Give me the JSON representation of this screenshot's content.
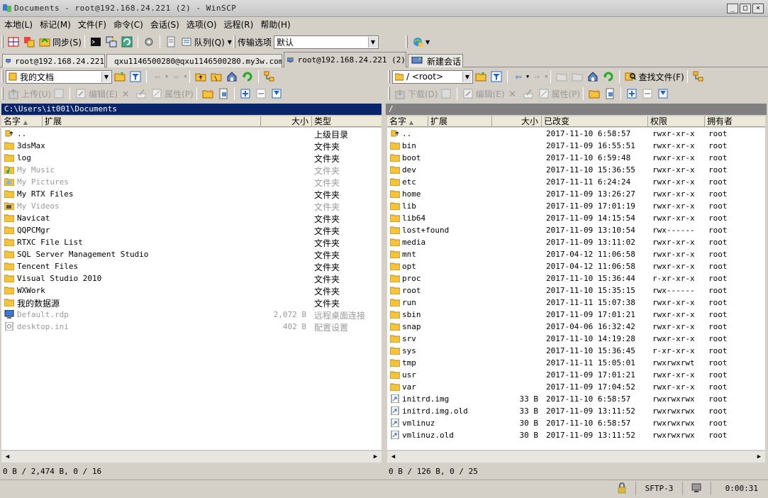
{
  "window": {
    "title": "Documents - root@192.168.24.221 (2) - WinSCP",
    "min": "_",
    "max": "□",
    "close": "×"
  },
  "menu": [
    "本地(L)",
    "标记(M)",
    "文件(F)",
    "命令(C)",
    "会话(S)",
    "选项(O)",
    "远程(R)",
    "帮助(H)"
  ],
  "toolbar1": {
    "sync": "同步(S)",
    "queue": "队列(Q)",
    "transfer_label": "传输选项",
    "transfer_value": "默认"
  },
  "tabs": [
    {
      "label": "root@192.168.24.221"
    },
    {
      "label": "qxu1146500280@qxu1146500280.my3w.com"
    },
    {
      "label": "root@192.168.24.221 (2)"
    },
    {
      "label": "新建会话"
    }
  ],
  "local": {
    "location": "我的文档",
    "upload": "上传(U)",
    "edit": "编辑(E)",
    "props": "属性(P)",
    "path": "C:\\Users\\it001\\Documents",
    "cols": {
      "name": "名字",
      "ext": "扩展",
      "size": "大小",
      "type": "类型"
    },
    "files": [
      {
        "name": "..",
        "size": "",
        "type": "上级目录",
        "icon": "parent-dir-icon",
        "dim": false
      },
      {
        "name": "3dsMax",
        "size": "",
        "type": "文件夹",
        "icon": "folder-icon",
        "dim": false
      },
      {
        "name": "log",
        "size": "",
        "type": "文件夹",
        "icon": "folder-icon",
        "dim": false
      },
      {
        "name": "My Music",
        "size": "",
        "type": "文件夹",
        "icon": "music-folder-icon",
        "dim": true
      },
      {
        "name": "My Pictures",
        "size": "",
        "type": "文件夹",
        "icon": "pictures-folder-icon",
        "dim": true
      },
      {
        "name": "My RTX Files",
        "size": "",
        "type": "文件夹",
        "icon": "folder-icon",
        "dim": false
      },
      {
        "name": "My Videos",
        "size": "",
        "type": "文件夹",
        "icon": "videos-folder-icon",
        "dim": true
      },
      {
        "name": "Navicat",
        "size": "",
        "type": "文件夹",
        "icon": "folder-icon",
        "dim": false
      },
      {
        "name": "QQPCMgr",
        "size": "",
        "type": "文件夹",
        "icon": "folder-icon",
        "dim": false
      },
      {
        "name": "RTXC File List",
        "size": "",
        "type": "文件夹",
        "icon": "folder-icon",
        "dim": false
      },
      {
        "name": "SQL Server Management Studio",
        "size": "",
        "type": "文件夹",
        "icon": "folder-icon",
        "dim": false
      },
      {
        "name": "Tencent Files",
        "size": "",
        "type": "文件夹",
        "icon": "folder-icon",
        "dim": false
      },
      {
        "name": "Visual Studio 2010",
        "size": "",
        "type": "文件夹",
        "icon": "folder-icon",
        "dim": false
      },
      {
        "name": "WXWork",
        "size": "",
        "type": "文件夹",
        "icon": "folder-icon",
        "dim": false
      },
      {
        "name": "我的数据源",
        "size": "",
        "type": "文件夹",
        "icon": "folder-icon",
        "dim": false
      },
      {
        "name": "Default.rdp",
        "size": "2,072 B",
        "type": "远程桌面连接",
        "icon": "rdp-file-icon",
        "dim": true
      },
      {
        "name": "desktop.ini",
        "size": "402 B",
        "type": "配置设置",
        "icon": "ini-file-icon",
        "dim": true
      }
    ],
    "status": "0 B / 2,474 B,  0 / 16"
  },
  "remote": {
    "location": "/ <root>",
    "download": "下载(D)",
    "edit": "编辑(E)",
    "props": "属性(P)",
    "find": "查找文件(F)",
    "path": "/",
    "cols": {
      "name": "名字",
      "ext": "扩展",
      "size": "大小",
      "changed": "已改变",
      "rights": "权限",
      "owner": "拥有者"
    },
    "files": [
      {
        "name": "..",
        "size": "",
        "changed": "2017-11-10 6:58:57",
        "rights": "rwxr-xr-x",
        "owner": "root",
        "icon": "parent-dir-icon"
      },
      {
        "name": "bin",
        "size": "",
        "changed": "2017-11-09 16:55:51",
        "rights": "rwxr-xr-x",
        "owner": "root",
        "icon": "folder-icon"
      },
      {
        "name": "boot",
        "size": "",
        "changed": "2017-11-10 6:59:48",
        "rights": "rwxr-xr-x",
        "owner": "root",
        "icon": "folder-icon"
      },
      {
        "name": "dev",
        "size": "",
        "changed": "2017-11-10 15:36:55",
        "rights": "rwxr-xr-x",
        "owner": "root",
        "icon": "folder-icon"
      },
      {
        "name": "etc",
        "size": "",
        "changed": "2017-11-11 6:24:24",
        "rights": "rwxr-xr-x",
        "owner": "root",
        "icon": "folder-icon"
      },
      {
        "name": "home",
        "size": "",
        "changed": "2017-11-09 13:26:27",
        "rights": "rwxr-xr-x",
        "owner": "root",
        "icon": "folder-icon"
      },
      {
        "name": "lib",
        "size": "",
        "changed": "2017-11-09 17:01:19",
        "rights": "rwxr-xr-x",
        "owner": "root",
        "icon": "folder-icon"
      },
      {
        "name": "lib64",
        "size": "",
        "changed": "2017-11-09 14:15:54",
        "rights": "rwxr-xr-x",
        "owner": "root",
        "icon": "folder-icon"
      },
      {
        "name": "lost+found",
        "size": "",
        "changed": "2017-11-09 13:10:54",
        "rights": "rwx------",
        "owner": "root",
        "icon": "folder-icon"
      },
      {
        "name": "media",
        "size": "",
        "changed": "2017-11-09 13:11:02",
        "rights": "rwxr-xr-x",
        "owner": "root",
        "icon": "folder-icon"
      },
      {
        "name": "mnt",
        "size": "",
        "changed": "2017-04-12 11:06:58",
        "rights": "rwxr-xr-x",
        "owner": "root",
        "icon": "folder-icon"
      },
      {
        "name": "opt",
        "size": "",
        "changed": "2017-04-12 11:06:58",
        "rights": "rwxr-xr-x",
        "owner": "root",
        "icon": "folder-icon"
      },
      {
        "name": "proc",
        "size": "",
        "changed": "2017-11-10 15:36:44",
        "rights": "r-xr-xr-x",
        "owner": "root",
        "icon": "folder-icon"
      },
      {
        "name": "root",
        "size": "",
        "changed": "2017-11-10 15:35:15",
        "rights": "rwx------",
        "owner": "root",
        "icon": "folder-icon"
      },
      {
        "name": "run",
        "size": "",
        "changed": "2017-11-11 15:07:38",
        "rights": "rwxr-xr-x",
        "owner": "root",
        "icon": "folder-icon"
      },
      {
        "name": "sbin",
        "size": "",
        "changed": "2017-11-09 17:01:21",
        "rights": "rwxr-xr-x",
        "owner": "root",
        "icon": "folder-icon"
      },
      {
        "name": "snap",
        "size": "",
        "changed": "2017-04-06 16:32:42",
        "rights": "rwxr-xr-x",
        "owner": "root",
        "icon": "folder-icon"
      },
      {
        "name": "srv",
        "size": "",
        "changed": "2017-11-10 14:19:28",
        "rights": "rwxr-xr-x",
        "owner": "root",
        "icon": "folder-icon"
      },
      {
        "name": "sys",
        "size": "",
        "changed": "2017-11-10 15:36:45",
        "rights": "r-xr-xr-x",
        "owner": "root",
        "icon": "folder-icon"
      },
      {
        "name": "tmp",
        "size": "",
        "changed": "2017-11-11 15:05:01",
        "rights": "rwxrwxrwt",
        "owner": "root",
        "icon": "folder-icon"
      },
      {
        "name": "usr",
        "size": "",
        "changed": "2017-11-09 17:01:21",
        "rights": "rwxr-xr-x",
        "owner": "root",
        "icon": "folder-icon"
      },
      {
        "name": "var",
        "size": "",
        "changed": "2017-11-09 17:04:52",
        "rights": "rwxr-xr-x",
        "owner": "root",
        "icon": "folder-icon"
      },
      {
        "name": "initrd.img",
        "size": "33 B",
        "changed": "2017-11-10 6:58:57",
        "rights": "rwxrwxrwx",
        "owner": "root",
        "icon": "symlink-icon"
      },
      {
        "name": "initrd.img.old",
        "size": "33 B",
        "changed": "2017-11-09 13:11:52",
        "rights": "rwxrwxrwx",
        "owner": "root",
        "icon": "symlink-icon"
      },
      {
        "name": "vmlinuz",
        "size": "30 B",
        "changed": "2017-11-10 6:58:57",
        "rights": "rwxrwxrwx",
        "owner": "root",
        "icon": "symlink-icon"
      },
      {
        "name": "vmlinuz.old",
        "size": "30 B",
        "changed": "2017-11-09 13:11:52",
        "rights": "rwxrwxrwx",
        "owner": "root",
        "icon": "symlink-icon"
      }
    ],
    "status": "0 B / 126 B,  0 / 25"
  },
  "bottom": {
    "protocol": "SFTP-3",
    "timer": "0:00:31"
  },
  "colors": {
    "path_active": "#0a246a",
    "path_inactive": "#808080",
    "folder": "#f3c43c"
  }
}
